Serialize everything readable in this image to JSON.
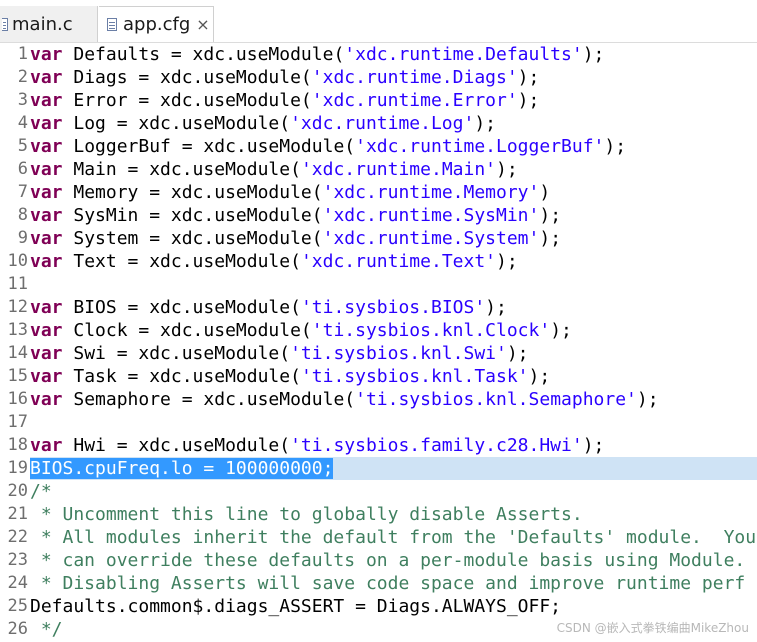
{
  "tabs": [
    {
      "label": "main.c"
    },
    {
      "label": "app.cfg",
      "close": "×"
    }
  ],
  "lines": [
    {
      "n": "1",
      "kw": "var",
      "rest": " Defaults = xdc.useModule(",
      "str": "'xdc.runtime.Defaults'",
      "tail": ");"
    },
    {
      "n": "2",
      "kw": "var",
      "rest": " Diags = xdc.useModule(",
      "str": "'xdc.runtime.Diags'",
      "tail": ");"
    },
    {
      "n": "3",
      "kw": "var",
      "rest": " Error = xdc.useModule(",
      "str": "'xdc.runtime.Error'",
      "tail": ");"
    },
    {
      "n": "4",
      "kw": "var",
      "rest": " Log = xdc.useModule(",
      "str": "'xdc.runtime.Log'",
      "tail": ");"
    },
    {
      "n": "5",
      "kw": "var",
      "rest": " LoggerBuf = xdc.useModule(",
      "str": "'xdc.runtime.LoggerBuf'",
      "tail": ");"
    },
    {
      "n": "6",
      "kw": "var",
      "rest": " Main = xdc.useModule(",
      "str": "'xdc.runtime.Main'",
      "tail": ");"
    },
    {
      "n": "7",
      "kw": "var",
      "rest": " Memory = xdc.useModule(",
      "str": "'xdc.runtime.Memory'",
      "tail": ")"
    },
    {
      "n": "8",
      "kw": "var",
      "rest": " SysMin = xdc.useModule(",
      "str": "'xdc.runtime.SysMin'",
      "tail": ");"
    },
    {
      "n": "9",
      "kw": "var",
      "rest": " System = xdc.useModule(",
      "str": "'xdc.runtime.System'",
      "tail": ");"
    },
    {
      "n": "10",
      "kw": "var",
      "rest": " Text = xdc.useModule(",
      "str": "'xdc.runtime.Text'",
      "tail": ");"
    },
    {
      "n": "11",
      "kw": "",
      "rest": "",
      "str": "",
      "tail": ""
    },
    {
      "n": "12",
      "kw": "var",
      "rest": " BIOS = xdc.useModule(",
      "str": "'ti.sysbios.BIOS'",
      "tail": ");"
    },
    {
      "n": "13",
      "kw": "var",
      "rest": " Clock = xdc.useModule(",
      "str": "'ti.sysbios.knl.Clock'",
      "tail": ");"
    },
    {
      "n": "14",
      "kw": "var",
      "rest": " Swi = xdc.useModule(",
      "str": "'ti.sysbios.knl.Swi'",
      "tail": ");"
    },
    {
      "n": "15",
      "kw": "var",
      "rest": " Task = xdc.useModule(",
      "str": "'ti.sysbios.knl.Task'",
      "tail": ");"
    },
    {
      "n": "16",
      "kw": "var",
      "rest": " Semaphore = xdc.useModule(",
      "str": "'ti.sysbios.knl.Semaphore'",
      "tail": ");"
    },
    {
      "n": "17",
      "kw": "",
      "rest": "",
      "str": "",
      "tail": ""
    },
    {
      "n": "18",
      "kw": "var",
      "rest": " Hwi = xdc.useModule(",
      "str": "'ti.sysbios.family.c28.Hwi'",
      "tail": ");"
    },
    {
      "n": "19",
      "selected": "BIOS.cpuFreq.lo = 100000000;"
    },
    {
      "n": "20",
      "comment": "/*"
    },
    {
      "n": "21",
      "comment": " * Uncomment this line to globally disable Asserts."
    },
    {
      "n": "22",
      "comment": " * All modules inherit the default from the 'Defaults' module.  You"
    },
    {
      "n": "23",
      "comment": " * can override these defaults on a per-module basis using Module."
    },
    {
      "n": "24",
      "comment": " * Disabling Asserts will save code space and improve runtime perf"
    },
    {
      "n": "25",
      "plain": "Defaults.common$.diags_ASSERT = Diags.ALWAYS_OFF;"
    },
    {
      "n": "26",
      "comment": " */"
    }
  ],
  "watermark": "CSDN @嵌入式拳铁编曲MikeZhou",
  "colors": {
    "keyword": "#7f0055",
    "string": "#2a00ff",
    "comment": "#3f7f5f",
    "selection": "#3399ff",
    "current_line": "#cfe3f5"
  }
}
